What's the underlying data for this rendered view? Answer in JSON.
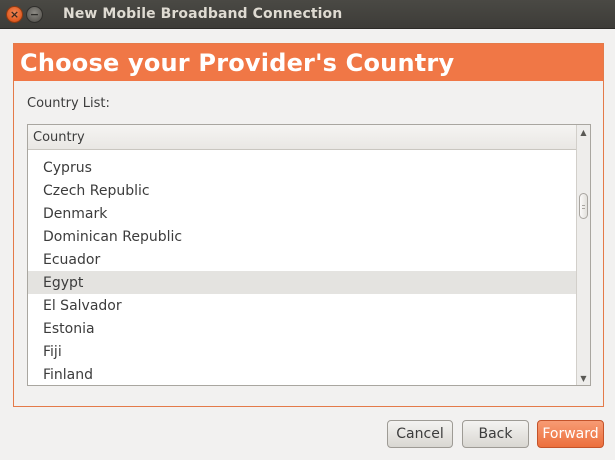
{
  "window": {
    "title": "New Mobile Broadband Connection",
    "close_glyph": "×",
    "minimize_glyph": "−"
  },
  "page": {
    "banner_title": "Choose your Provider's Country",
    "list_label": "Country List:",
    "column_header": "Country"
  },
  "countries": [
    {
      "name": "Cyprus",
      "selected": false
    },
    {
      "name": "Czech Republic",
      "selected": false
    },
    {
      "name": "Denmark",
      "selected": false
    },
    {
      "name": "Dominican Republic",
      "selected": false
    },
    {
      "name": "Ecuador",
      "selected": false
    },
    {
      "name": "Egypt",
      "selected": true
    },
    {
      "name": "El Salvador",
      "selected": false
    },
    {
      "name": "Estonia",
      "selected": false
    },
    {
      "name": "Fiji",
      "selected": false
    },
    {
      "name": "Finland",
      "selected": false
    }
  ],
  "buttons": {
    "cancel": "Cancel",
    "back": "Back",
    "forward": "Forward"
  },
  "colors": {
    "accent": "#f07746",
    "selected_row": "#e4e3e0"
  }
}
